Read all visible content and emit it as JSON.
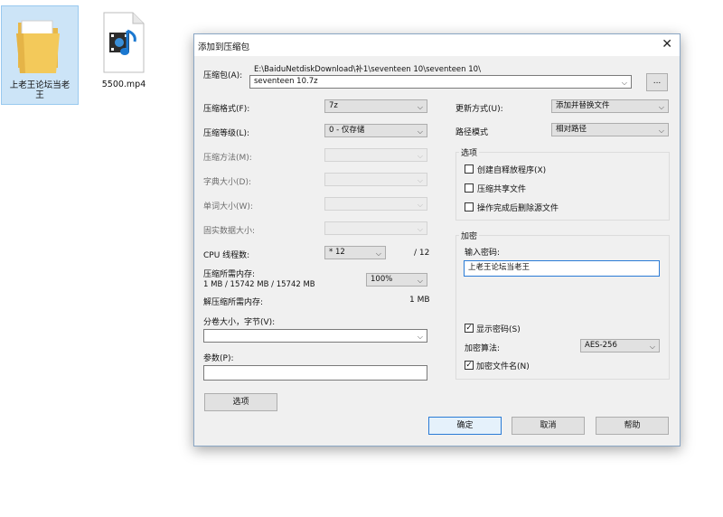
{
  "desktop": {
    "items": [
      {
        "label_line1": "上老王论坛当老",
        "label_line2": "王",
        "icon": "folder-icon"
      },
      {
        "label_line1": "5500.mp4",
        "icon": "video-file-icon"
      }
    ]
  },
  "dialog": {
    "title": "添加到压缩包",
    "close": "✕",
    "archive": {
      "label": "压缩包(A):",
      "path": "E:\\BaiduNetdiskDownload\\补1\\seventeen 10\\seventeen 10\\",
      "filename": "seventeen 10.7z",
      "browse": "..."
    },
    "left": {
      "format": {
        "label": "压缩格式(F):",
        "value": "7z"
      },
      "level": {
        "label": "压缩等级(L):",
        "value": "0 - 仅存储"
      },
      "method": {
        "label": "压缩方法(M):",
        "value": ""
      },
      "dict": {
        "label": "字典大小(D):",
        "value": ""
      },
      "word": {
        "label": "单词大小(W):",
        "value": ""
      },
      "solid": {
        "label": "固实数据大小:",
        "value": ""
      },
      "cpu": {
        "label": "CPU 线程数:",
        "value": "* 12",
        "max": "/ 12"
      },
      "mem_compress": {
        "label": "压缩所需内存:",
        "detail": "1 MB / 15742 MB / 15742 MB",
        "percent": "100%"
      },
      "mem_decompress": {
        "label": "解压缩所需内存:",
        "value": "1 MB"
      },
      "volume": {
        "label": "分卷大小，字节(V):",
        "value": ""
      },
      "params": {
        "label": "参数(P):",
        "value": ""
      },
      "options_button": "选项"
    },
    "right": {
      "update": {
        "label": "更新方式(U):",
        "value": "添加并替换文件"
      },
      "path_mode": {
        "label": "路径模式",
        "value": "相对路径"
      },
      "options": {
        "title": "选项",
        "sfx": "创建自释放程序(X)",
        "shared": "压缩共享文件",
        "delete": "操作完成后删除源文件"
      },
      "encryption": {
        "title": "加密",
        "password_label": "输入密码:",
        "password_value": "上老王论坛当老王",
        "show_password": "显示密码(S)",
        "method_label": "加密算法:",
        "method_value": "AES-256",
        "encrypt_names": "加密文件名(N)"
      }
    },
    "buttons": {
      "ok": "确定",
      "cancel": "取消",
      "help": "帮助"
    }
  }
}
